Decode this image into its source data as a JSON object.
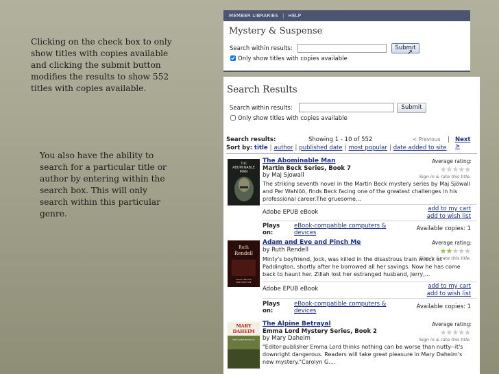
{
  "captions": {
    "first": "Clicking on the check box to only show titles with copies available and clicking the submit button modifies the results to show 552 titles with copies available.",
    "second": "You also have the ability to search for a particular title or author by entering within the search box.  This will only search within this particular genre."
  },
  "top_screenshot": {
    "nav": [
      "MEMBER LIBRARIES",
      "HELP"
    ],
    "genre_title": "Mystery & Suspense",
    "search_label": "Search within results:",
    "search_value": "",
    "submit_label": "Submit",
    "checkbox_label": "Only show titles with copies available",
    "checkbox_checked": true
  },
  "main_screenshot": {
    "header": "Search Results",
    "search_label": "Search within results:",
    "search_value": "",
    "submit_label": "Submit",
    "checkbox_label": "Only show titles with copies available",
    "checkbox_checked": false,
    "results_label": "Search results:",
    "showing_text": "Showing 1 - 10 of 552",
    "prev_label": "< Previous",
    "next_label": "Next >",
    "sort_label": "Sort by:",
    "sort_options": [
      "title",
      "author",
      "published date",
      "most popular",
      "date added to site"
    ],
    "books": [
      {
        "title": "The Abominable Man",
        "series": "Martin Beck Series, Book 7",
        "author": "by Maj Sjowall",
        "description": "The striking seventh novel in the Martin Beck mystery series by Maj Sjöwall and Per Wahlöö, finds Beck facing one of the greatest challenges in his professional career.The gruesome...",
        "avg_label": "Average rating:",
        "rate_label": "Sign in & rate this title.",
        "rating": 0,
        "format": "Adobe EPUB eBook",
        "cart_label": "add to my cart",
        "wish_label": "add to wish list",
        "plays_label": "Plays on:",
        "devices_label": "eBook-compatible computers & devices",
        "copies": "Available copies: 1",
        "cover_text": [
          "THE",
          "ABOMINABLE",
          "MAN"
        ]
      },
      {
        "title": "Adam and Eve and Pinch Me",
        "series": "",
        "author": "by Ruth Rendell",
        "description": "Minty's boyfriend, Jock, was killed in the disastrous train wreck at Paddington, shortly after he borrowed all her savings. Now he has come back to haunt her. Zillah lost her estranged husband, Jerry,...",
        "avg_label": "Average rating:",
        "rate_label": "Sign in & rate this title.",
        "rating": 2,
        "format": "Adobe EPUB eBook",
        "cart_label": "add to my cart",
        "wish_label": "add to wish list",
        "plays_label": "Plays on:",
        "devices_label": "eBook-compatible computers & devices",
        "copies": "Available copies: 1",
        "cover_text": [
          "Ruth",
          "Rendell",
          "ADAM AND EVE",
          "AND PINCH ME"
        ]
      },
      {
        "title": "The Alpine Betrayal",
        "series": "Emma Lord Mystery Series, Book 2",
        "author": "by Mary Daheim",
        "description": "\"Editor-publisher Emma Lord thinks nothing can be worse than nutty--it's downright dangerous. Readers will take great pleasure in Mary Daheim's new mystery.\"Carolyn G....",
        "avg_label": "Average rating:",
        "rate_label": "Sign in & rate this title.",
        "rating": 0,
        "cover_text": [
          "MARY",
          "DAHEIM",
          "THE ALPINE BETRAYAL"
        ]
      }
    ]
  }
}
